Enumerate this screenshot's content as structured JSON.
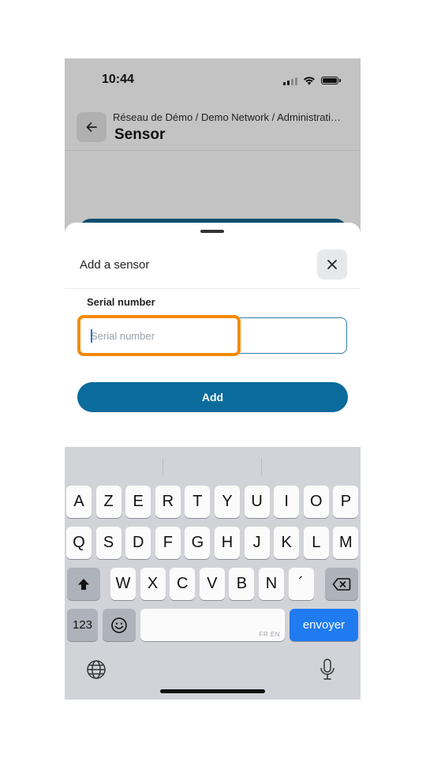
{
  "status_bar": {
    "time": "10:44"
  },
  "header": {
    "breadcrumb": "Réseau de Démo / Demo Network / Administrati…",
    "title": "Sensor"
  },
  "sheet": {
    "title": "Add a sensor",
    "field_label": "Serial number",
    "serial_input": {
      "value": "",
      "placeholder": "Serial number"
    },
    "add_button_label": "Add"
  },
  "keyboard": {
    "row1": [
      "A",
      "Z",
      "E",
      "R",
      "T",
      "Y",
      "U",
      "I",
      "O",
      "P"
    ],
    "row2": [
      "Q",
      "S",
      "D",
      "F",
      "G",
      "H",
      "J",
      "K",
      "L",
      "M"
    ],
    "row3": [
      "W",
      "X",
      "C",
      "V",
      "B",
      "N",
      "´"
    ],
    "numbers_key": "123",
    "space_language_hint": "FR EN",
    "return_key": "envoyer"
  },
  "colors": {
    "primary": "#0b6b9c",
    "highlight": "#f58a0b",
    "return_key": "#1f7bef"
  }
}
